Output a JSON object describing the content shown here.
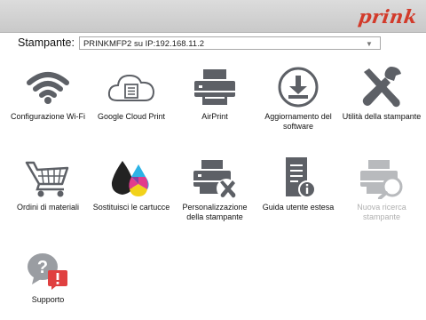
{
  "header": {
    "logo_text": "prink",
    "brand_color": "#d23a2a"
  },
  "printer": {
    "label": "Stampante:",
    "selected": "PRINKMFP2 su IP:192.168.11.2"
  },
  "tiles": [
    {
      "label": "Configurazione Wi-Fi",
      "icon": "wifi-icon",
      "enabled": true
    },
    {
      "label": "Google Cloud Print",
      "icon": "cloud-print-icon",
      "enabled": true
    },
    {
      "label": "AirPrint",
      "icon": "printer-icon",
      "enabled": true
    },
    {
      "label": "Aggiornamento del software",
      "icon": "download-icon",
      "enabled": true
    },
    {
      "label": "Utilità della stampante",
      "icon": "tools-icon",
      "enabled": true
    },
    {
      "label": "Ordini di materiali",
      "icon": "shopping-cart-icon",
      "enabled": true
    },
    {
      "label": "Sostituisci le cartucce",
      "icon": "ink-drops-icon",
      "enabled": true
    },
    {
      "label": "Personalizzazione della stampante",
      "icon": "printer-settings-icon",
      "enabled": true
    },
    {
      "label": "Guida utente estesa",
      "icon": "user-guide-icon",
      "enabled": true
    },
    {
      "label": "Nuova ricerca stampante",
      "icon": "printer-search-icon",
      "enabled": false
    },
    {
      "label": "Supporto",
      "icon": "support-icon",
      "enabled": true
    }
  ],
  "colors": {
    "icon_gray": "#5d6066",
    "disabled_gray": "#b0b0b0",
    "support_red": "#e04040"
  }
}
